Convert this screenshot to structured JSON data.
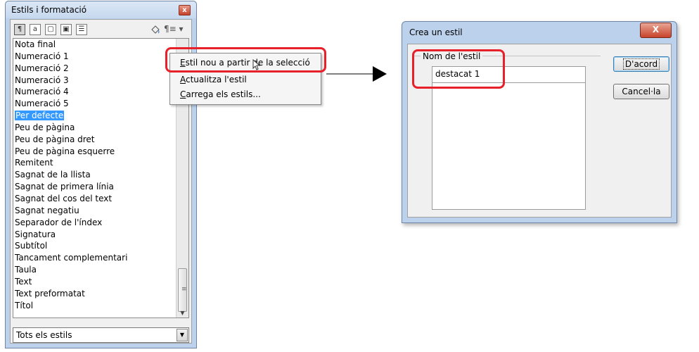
{
  "styles_panel": {
    "title": "Estils i formatació",
    "close": "x",
    "toolbar": {
      "buttons": [
        "¶",
        "a",
        "▢",
        "▣",
        "☰"
      ],
      "fill_icon": "paint-bucket-icon",
      "new_style_icon": "¶≡ ▾"
    },
    "items": [
      "Nota final",
      "Numeració 1",
      "Numeració 2",
      "Numeració 3",
      "Numeració 4",
      "Numeració 5",
      "Per defecte",
      "Peu de pàgina",
      "Peu de pàgina dret",
      "Peu de pàgina esquerre",
      "Remitent",
      "Sagnat de la llista",
      "Sagnat de primera línia",
      "Sagnat del cos del text",
      "Sagnat negatiu",
      "Separador de l'índex",
      "Signatura",
      "Subtítol",
      "Tancament complementari",
      "Taula",
      "Text",
      "Text preformatat",
      "Títol"
    ],
    "selected_item": "Per defecte",
    "filter_value": "Tots els estils"
  },
  "context_menu": {
    "items": [
      {
        "prefix": "",
        "mnemonic": "E",
        "rest": "stil nou a partir de la selecció"
      },
      {
        "prefix": "",
        "mnemonic": "A",
        "rest": "ctualitza l'estil"
      },
      {
        "prefix": "",
        "mnemonic": "C",
        "rest": "arrega els estils..."
      }
    ]
  },
  "dialog": {
    "title": "Crea un estil",
    "close": "X",
    "group_label": "Nom de l'estil",
    "name_value": "destacat 1",
    "ok_label": "D'acord",
    "cancel_label": "Cancel·la"
  },
  "colors": {
    "highlight": "#e8202a",
    "selection": "#3399ff",
    "frame": "#bcd2ec"
  }
}
